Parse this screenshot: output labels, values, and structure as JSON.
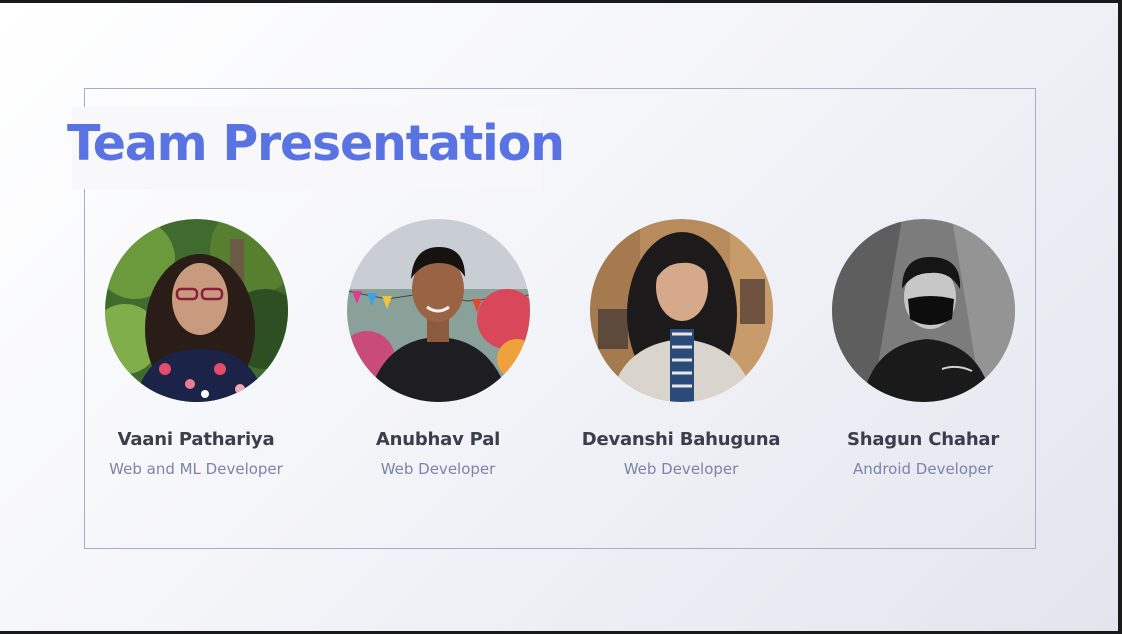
{
  "slide": {
    "title": "Team Presentation",
    "accent_color": "#5a73e3",
    "members": [
      {
        "name": "Vaani Pathariya",
        "role": "Web and ML Developer",
        "photo": "portrait-photo-woman-glasses-floral-shirt"
      },
      {
        "name": "Anubhav Pal",
        "role": "Web Developer",
        "photo": "portrait-photo-man-black-shirt"
      },
      {
        "name": "Devanshi Bahuguna",
        "role": "Web Developer",
        "photo": "portrait-photo-woman-scarf"
      },
      {
        "name": "Shagun Chahar",
        "role": "Android Developer",
        "photo": "portrait-photo-person-face-mask-grayscale"
      }
    ]
  }
}
